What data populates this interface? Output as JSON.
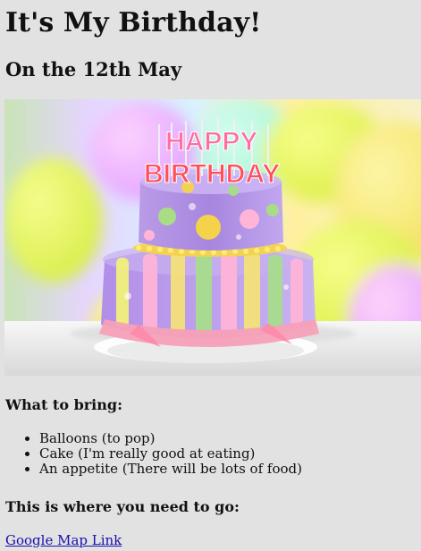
{
  "page": {
    "title": "It's My Birthday!",
    "subtitle": "On the 12th May"
  },
  "hero_image": {
    "alt": "Birthday cake with candles spelling HAPPY BIRTHDAY",
    "candle_text_top": "HAPPY",
    "candle_text_bottom": "BIRTHDAY"
  },
  "bring": {
    "heading": "What to bring:",
    "items": [
      "Balloons (to pop)",
      "Cake (I'm really good at eating)",
      "An appetite (There will be lots of food)"
    ]
  },
  "location": {
    "heading": "This is where you need to go:",
    "link_text": "Google Map Link"
  },
  "colors": {
    "background": "#e2e2e2",
    "link": "#1a0dab"
  }
}
